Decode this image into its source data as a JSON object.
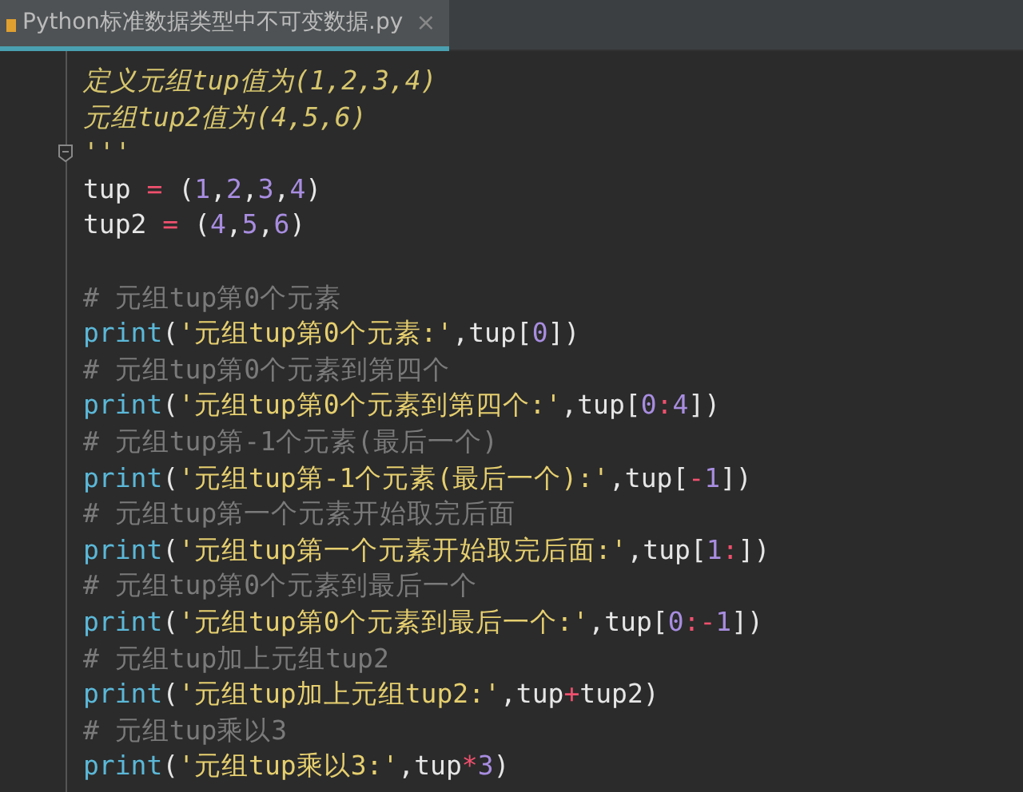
{
  "tab": {
    "title": "Python标准数据类型中不可变数据.py",
    "close": "×",
    "selected": true
  },
  "lines": [
    {
      "kind": "code",
      "fold": false,
      "tokens": [
        {
          "kind": "docstring",
          "text": "定义元组tup值为(1,2,3,4)"
        }
      ]
    },
    {
      "kind": "code",
      "fold": false,
      "tokens": [
        {
          "kind": "docstring",
          "text": "元组tup2值为(4,5,6)"
        }
      ]
    },
    {
      "kind": "code",
      "fold": true,
      "tokens": [
        {
          "kind": "docstring",
          "text": "'''"
        }
      ]
    },
    {
      "kind": "code",
      "fold": false,
      "tokens": [
        {
          "kind": "plain",
          "text": "tup "
        },
        {
          "kind": "operator",
          "text": "="
        },
        {
          "kind": "plain",
          "text": " ("
        },
        {
          "kind": "number",
          "text": "1"
        },
        {
          "kind": "plain",
          "text": ","
        },
        {
          "kind": "number",
          "text": "2"
        },
        {
          "kind": "plain",
          "text": ","
        },
        {
          "kind": "number",
          "text": "3"
        },
        {
          "kind": "plain",
          "text": ","
        },
        {
          "kind": "number",
          "text": "4"
        },
        {
          "kind": "plain",
          "text": ")"
        }
      ]
    },
    {
      "kind": "code",
      "fold": false,
      "tokens": [
        {
          "kind": "plain",
          "text": "tup2 "
        },
        {
          "kind": "operator",
          "text": "="
        },
        {
          "kind": "plain",
          "text": " ("
        },
        {
          "kind": "number",
          "text": "4"
        },
        {
          "kind": "plain",
          "text": ","
        },
        {
          "kind": "number",
          "text": "5"
        },
        {
          "kind": "plain",
          "text": ","
        },
        {
          "kind": "number",
          "text": "6"
        },
        {
          "kind": "plain",
          "text": ")"
        }
      ]
    },
    {
      "kind": "blank"
    },
    {
      "kind": "code",
      "fold": false,
      "tokens": [
        {
          "kind": "comment",
          "text": "# 元组tup第0个元素"
        }
      ]
    },
    {
      "kind": "code",
      "fold": false,
      "tokens": [
        {
          "kind": "builtin",
          "text": "print"
        },
        {
          "kind": "plain",
          "text": "("
        },
        {
          "kind": "string",
          "text": "'元组tup第0个元素:'"
        },
        {
          "kind": "plain",
          "text": ",tup["
        },
        {
          "kind": "number",
          "text": "0"
        },
        {
          "kind": "plain",
          "text": "])"
        }
      ]
    },
    {
      "kind": "code",
      "fold": false,
      "tokens": [
        {
          "kind": "comment",
          "text": "# 元组tup第0个元素到第四个"
        }
      ]
    },
    {
      "kind": "code",
      "fold": false,
      "tokens": [
        {
          "kind": "builtin",
          "text": "print"
        },
        {
          "kind": "plain",
          "text": "("
        },
        {
          "kind": "string",
          "text": "'元组tup第0个元素到第四个:'"
        },
        {
          "kind": "plain",
          "text": ",tup["
        },
        {
          "kind": "number",
          "text": "0"
        },
        {
          "kind": "operator",
          "text": ":"
        },
        {
          "kind": "number",
          "text": "4"
        },
        {
          "kind": "plain",
          "text": "])"
        }
      ]
    },
    {
      "kind": "code",
      "fold": false,
      "tokens": [
        {
          "kind": "comment",
          "text": "# 元组tup第-1个元素(最后一个)"
        }
      ]
    },
    {
      "kind": "code",
      "fold": false,
      "tokens": [
        {
          "kind": "builtin",
          "text": "print"
        },
        {
          "kind": "plain",
          "text": "("
        },
        {
          "kind": "string",
          "text": "'元组tup第-1个元素(最后一个):'"
        },
        {
          "kind": "plain",
          "text": ",tup["
        },
        {
          "kind": "operator",
          "text": "-"
        },
        {
          "kind": "number",
          "text": "1"
        },
        {
          "kind": "plain",
          "text": "])"
        }
      ]
    },
    {
      "kind": "code",
      "fold": false,
      "tokens": [
        {
          "kind": "comment",
          "text": "# 元组tup第一个元素开始取完后面"
        }
      ]
    },
    {
      "kind": "code",
      "fold": false,
      "tokens": [
        {
          "kind": "builtin",
          "text": "print"
        },
        {
          "kind": "plain",
          "text": "("
        },
        {
          "kind": "string",
          "text": "'元组tup第一个元素开始取完后面:'"
        },
        {
          "kind": "plain",
          "text": ",tup["
        },
        {
          "kind": "number",
          "text": "1"
        },
        {
          "kind": "operator",
          "text": ":"
        },
        {
          "kind": "plain",
          "text": "])"
        }
      ]
    },
    {
      "kind": "code",
      "fold": false,
      "tokens": [
        {
          "kind": "comment",
          "text": "# 元组tup第0个元素到最后一个"
        }
      ]
    },
    {
      "kind": "code",
      "fold": false,
      "tokens": [
        {
          "kind": "builtin",
          "text": "print"
        },
        {
          "kind": "plain",
          "text": "("
        },
        {
          "kind": "string",
          "text": "'元组tup第0个元素到最后一个:'"
        },
        {
          "kind": "plain",
          "text": ",tup["
        },
        {
          "kind": "number",
          "text": "0"
        },
        {
          "kind": "operator",
          "text": ":-"
        },
        {
          "kind": "number",
          "text": "1"
        },
        {
          "kind": "plain",
          "text": "])"
        }
      ]
    },
    {
      "kind": "code",
      "fold": false,
      "tokens": [
        {
          "kind": "comment",
          "text": "# 元组tup加上元组tup2"
        }
      ]
    },
    {
      "kind": "code",
      "fold": false,
      "tokens": [
        {
          "kind": "builtin",
          "text": "print"
        },
        {
          "kind": "plain",
          "text": "("
        },
        {
          "kind": "string",
          "text": "'元组tup加上元组tup2:'"
        },
        {
          "kind": "plain",
          "text": ",tup"
        },
        {
          "kind": "operator",
          "text": "+"
        },
        {
          "kind": "plain",
          "text": "tup2)"
        }
      ]
    },
    {
      "kind": "code",
      "fold": false,
      "tokens": [
        {
          "kind": "comment",
          "text": "# 元组tup乘以3"
        }
      ]
    },
    {
      "kind": "code",
      "fold": false,
      "tokens": [
        {
          "kind": "builtin",
          "text": "print"
        },
        {
          "kind": "plain",
          "text": "("
        },
        {
          "kind": "string",
          "text": "'元组tup乘以3:'"
        },
        {
          "kind": "plain",
          "text": ",tup"
        },
        {
          "kind": "operator",
          "text": "*"
        },
        {
          "kind": "number",
          "text": "3"
        },
        {
          "kind": "plain",
          "text": ")"
        }
      ]
    }
  ]
}
